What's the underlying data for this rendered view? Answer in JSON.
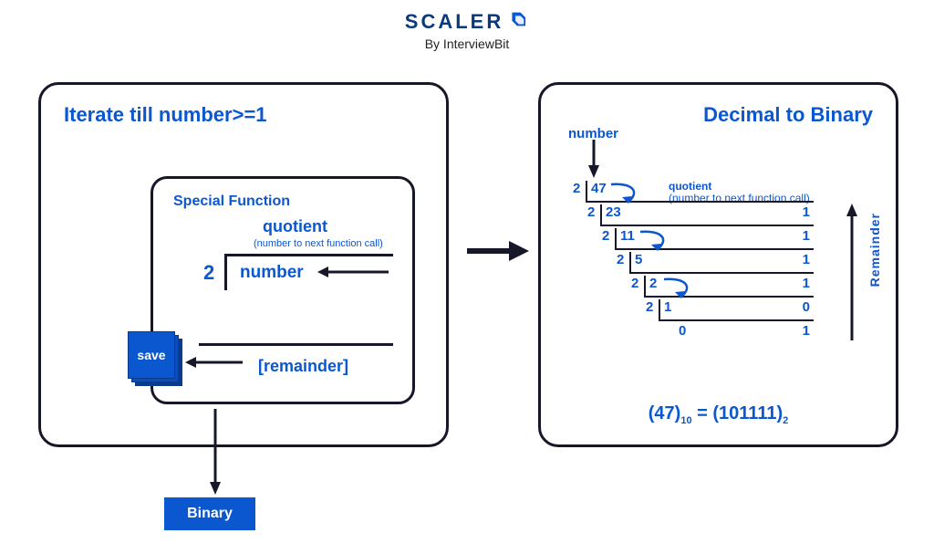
{
  "logo": {
    "main": "SCALER",
    "sub": "By InterviewBit"
  },
  "left": {
    "title": "Iterate till number>=1",
    "inner_title": "Special Function",
    "quotient": "quotient",
    "quotient_sub": "(number to next function call)",
    "divisor": "2",
    "number": "number",
    "remainder": "[remainder]",
    "save": "save",
    "binary": "Binary"
  },
  "right": {
    "title": "Decimal to Binary",
    "number_label": "number",
    "quotient_label": "quotient",
    "quotient_sub": "(number to next function call)",
    "remainder_label": "Remainder",
    "steps": [
      {
        "divisor": "2",
        "value": "47",
        "rem": ""
      },
      {
        "divisor": "2",
        "value": "23",
        "rem": "1"
      },
      {
        "divisor": "2",
        "value": "11",
        "rem": "1"
      },
      {
        "divisor": "2",
        "value": "5",
        "rem": "1"
      },
      {
        "divisor": "2",
        "value": "2",
        "rem": "1"
      },
      {
        "divisor": "2",
        "value": "1",
        "rem": "0"
      },
      {
        "divisor": "",
        "value": "0",
        "rem": "1"
      }
    ],
    "result_decimal": "47",
    "result_base_d": "10",
    "result_binary": "101111",
    "result_base_b": "2"
  }
}
